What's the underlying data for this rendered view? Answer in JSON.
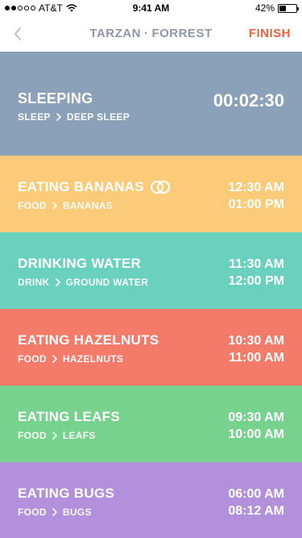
{
  "status_bar": {
    "carrier": "AT&T",
    "time": "9:41 AM",
    "battery_percent": "42%",
    "battery_level": 0.42,
    "signal_filled": 2,
    "signal_total": 5
  },
  "nav": {
    "title_left": "TARZAN",
    "title_separator": "·",
    "title_right": "FORREST",
    "finish_label": "FINISH"
  },
  "activities": [
    {
      "title": "SLEEPING",
      "category": "SLEEP",
      "subcategory": "DEEP SLEEP",
      "time_main": "00:02:30",
      "time_start": "",
      "time_end": "",
      "color": "#8aa1b9",
      "has_icon": false
    },
    {
      "title": "EATING BANANAS",
      "category": "FOOD",
      "subcategory": "BANANAS",
      "time_start": "12:30 AM",
      "time_end": "01:00 PM",
      "color": "#fbcb7a",
      "has_icon": true,
      "icon": "rings-icon"
    },
    {
      "title": "DRINKING WATER",
      "category": "DRINK",
      "subcategory": "GROUND WATER",
      "time_start": "11:30 AM",
      "time_end": "12:00 PM",
      "color": "#6ad1be",
      "has_icon": false
    },
    {
      "title": "EATING HAZELNUTS",
      "category": "FOOD",
      "subcategory": "HAZELNUTS",
      "time_start": "10:30 AM",
      "time_end": "11:00 AM",
      "color": "#f47b6a",
      "has_icon": false
    },
    {
      "title": "EATING LEAFS",
      "category": "FOOD",
      "subcategory": "LEAFS",
      "time_start": "09:30 AM",
      "time_end": "10:00 AM",
      "color": "#77d28e",
      "has_icon": false
    },
    {
      "title": "EATING BUGS",
      "category": "FOOD",
      "subcategory": "BUGS",
      "time_start": "06:00 AM",
      "time_end": "08:12 AM",
      "color": "#b290dc",
      "has_icon": false
    }
  ],
  "colors": {
    "nav_title": "#8f97a6",
    "finish": "#f0603e",
    "back_chevron": "#b8c0cc"
  },
  "icons": {
    "back": "chevron-left-icon",
    "breadcrumb_separator": "chevron-right-icon",
    "wifi": "wifi-icon",
    "battery": "battery-icon"
  }
}
